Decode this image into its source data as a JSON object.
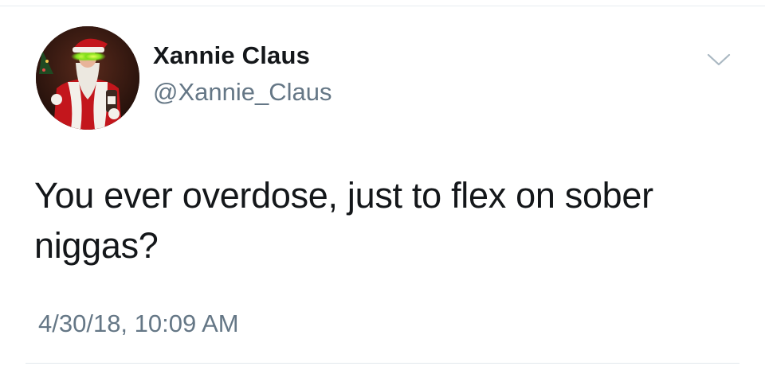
{
  "tweet": {
    "author": {
      "display_name": "Xannie Claus",
      "handle": "@Xannie_Claus",
      "avatar": "santa-claus-avatar"
    },
    "menu_icon": "chevron-down-icon",
    "text": "You ever overdose, just to flex on sober niggas?",
    "timestamp": "4/30/18, 10:09 AM"
  },
  "colors": {
    "text_primary": "#14171a",
    "text_secondary": "#657786",
    "divider": "#e6ecf0",
    "background": "#ffffff"
  }
}
